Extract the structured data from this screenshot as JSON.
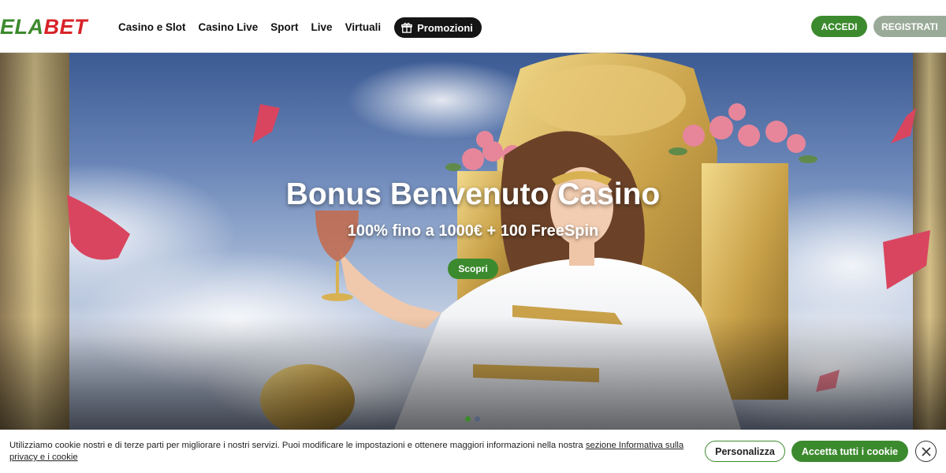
{
  "header": {
    "logo_green": "ELA",
    "logo_red": "BET",
    "nav": [
      "Casino e Slot",
      "Casino Live",
      "Sport",
      "Live",
      "Virtuali"
    ],
    "promo_label": "Promozioni",
    "login_label": "ACCEDI",
    "register_label": "REGISTRATI"
  },
  "hero": {
    "title": "Bonus Benvenuto Casino",
    "subtitle": "100% fino a 1000€ + 100 FreeSpin",
    "cta_label": "Scopri",
    "slides_total": 2,
    "active_slide": 1
  },
  "cookie": {
    "text": "Utilizziamo cookie nostri e di terze parti per migliorare i nostri servizi. Puoi modificare le impostazioni e ottenere maggiori informazioni nella nostra ",
    "link": "sezione Informativa sulla privacy e i cookie",
    "customize_label": "Personalizza",
    "accept_label": "Accetta tutti i cookie"
  },
  "colors": {
    "brand_green": "#3c8a2e",
    "brand_red": "#d8232a",
    "register_grey": "#9aaa98",
    "promo_dark": "#151515"
  },
  "icons": {
    "promo": "gift-icon",
    "close": "close-icon"
  }
}
